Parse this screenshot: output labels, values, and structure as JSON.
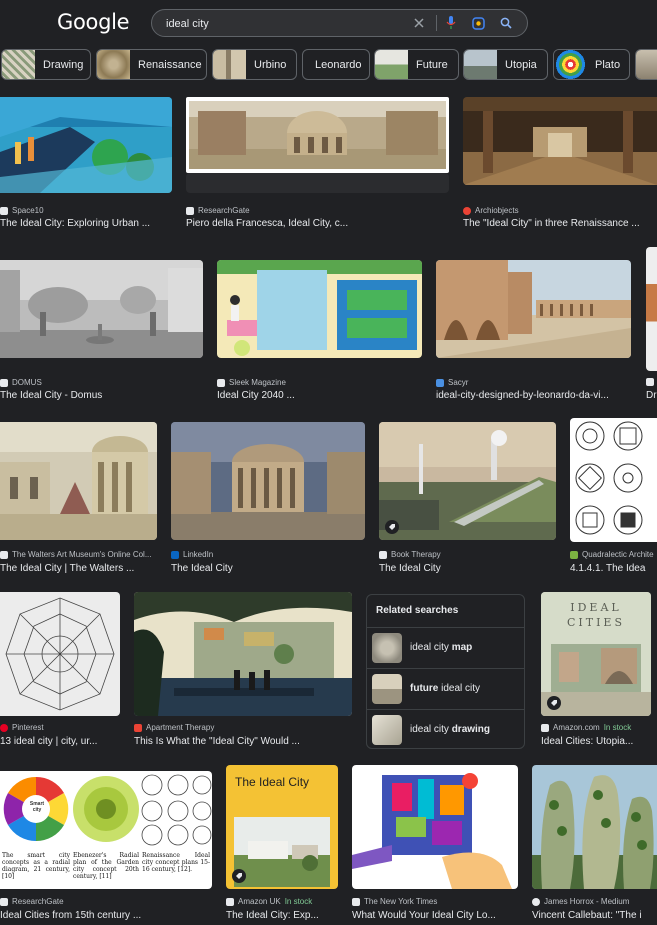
{
  "header": {
    "logo": "Google",
    "search": {
      "value": "ideal city"
    }
  },
  "chips": [
    {
      "label": "Drawing"
    },
    {
      "label": "Renaissance"
    },
    {
      "label": "Urbino"
    },
    {
      "label": "Leonardo"
    },
    {
      "label": "Future"
    },
    {
      "label": "Utopia"
    },
    {
      "label": "Plato"
    }
  ],
  "results": [
    {
      "source": "Space10",
      "title": "The Ideal City: Exploring Urban ..."
    },
    {
      "source": "ResearchGate",
      "title": "Piero della Francesca, Ideal City, c..."
    },
    {
      "source": "Archiobjects",
      "title": "The \"Ideal City\" in three Renaissance ..."
    },
    {
      "source": "DOMUS",
      "title": "The Ideal City - Domus"
    },
    {
      "source": "Sleek Magazine",
      "title": "Ideal City 2040 ..."
    },
    {
      "source": "Sacyr",
      "title": "ideal-city-designed-by-leonardo-da-vi..."
    },
    {
      "source": "",
      "title": "Dr"
    },
    {
      "source": "The Walters Art Museum's Online Col...",
      "title": "The Ideal City | The Walters ..."
    },
    {
      "source": "LinkedIn",
      "title": "The Ideal City"
    },
    {
      "source": "Book Therapy",
      "title": "The Ideal City"
    },
    {
      "source": "Quadralectic Archite",
      "title": "4.1.4.1. The Idea"
    },
    {
      "source": "Pinterest",
      "title": "13 ideal city | city, ur..."
    },
    {
      "source": "Apartment Therapy",
      "title": "This Is What the \"Ideal City\" Would ..."
    },
    {
      "source": "Amazon.com",
      "stock": "In stock",
      "title": "Ideal Cities: Utopia..."
    },
    {
      "source": "ResearchGate",
      "title": "Ideal Cities from 15th century ..."
    },
    {
      "source": "Amazon UK",
      "stock": "In stock",
      "title": "The Ideal City: Exp..."
    },
    {
      "source": "The New York Times",
      "title": "What Would Your Ideal City Lo..."
    },
    {
      "source": "James Horrox - Medium",
      "title": "Vincent Callebaut: \"The i"
    }
  ],
  "image_text": {
    "ideal_cities_cover": "IDEAL CITIES",
    "ideal_city_book": "The Ideal City",
    "smart_city": "Smart city",
    "caption1": "The smart city concepts as a radial diagram, 21 century, [10]",
    "caption2": "Ebenezer's Radial plan of the Garden city concept 20th century, [11]",
    "caption3": "Renaissance Ideal city concept plans 15-16 century, [12]."
  },
  "related": {
    "heading": "Related searches",
    "items": [
      {
        "pre": "ideal city ",
        "bold": "map",
        "post": ""
      },
      {
        "pre": "",
        "bold": "future",
        "post": " ideal city"
      },
      {
        "pre": "ideal city ",
        "bold": "drawing",
        "post": ""
      }
    ]
  }
}
